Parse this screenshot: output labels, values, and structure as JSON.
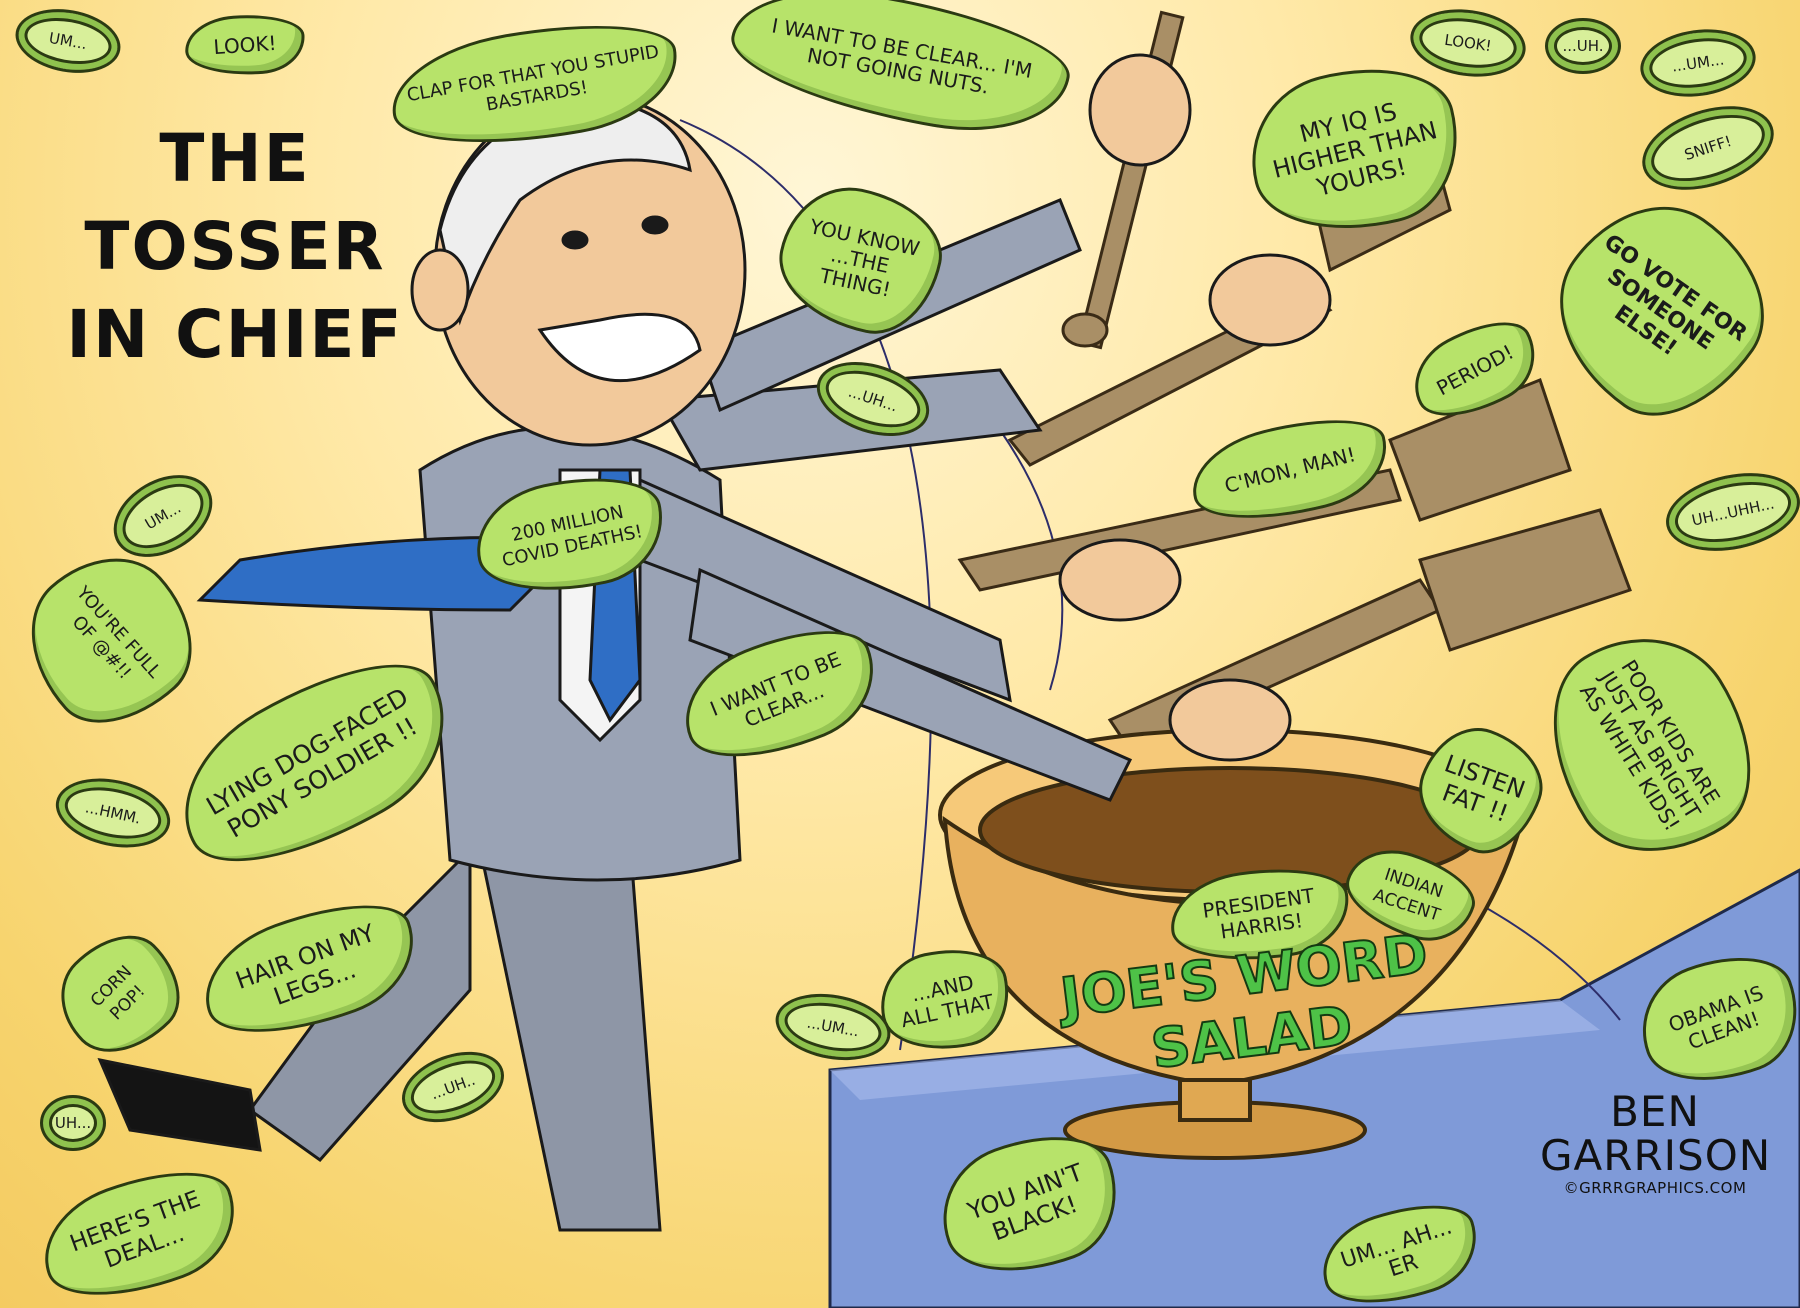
{
  "title_lines": [
    "THE",
    "TOSSER",
    "IN CHIEF"
  ],
  "bowl_label": [
    "JOE'S WORD",
    "SALAD"
  ],
  "signature": {
    "line1": "BEN",
    "line2": "GARRISON",
    "site": "©GRRRGRAPHICS.COM"
  },
  "leaves": [
    "CLAP FOR THAT YOU STUPID BASTARDS!",
    "I WANT TO BE CLEAR... I'M NOT GOING NUTS.",
    "MY IQ IS HIGHER THAN YOURS!",
    "YOU KNOW ...THE THING!",
    "GO VOTE FOR SOMEONE ELSE!",
    "PERIOD!",
    "C'MON, MAN!",
    "200 MILLION COVID DEATHS!",
    "YOU'RE FULL OF @#!!",
    "I WANT TO BE CLEAR...",
    "LYING DOG-FACED PONY SOLDIER !!",
    "POOR KIDS ARE JUST AS BRIGHT AS WHITE KIDS!",
    "LISTEN FAT !!",
    "PRESIDENT HARRIS!",
    "INDIAN ACCENT",
    "CORN POP!",
    "HAIR ON MY LEGS...",
    "...AND ALL THAT",
    "OBAMA IS CLEAN!",
    "YOU AIN'T BLACK!",
    "HERE'S THE DEAL...",
    "UM... AH... ER",
    "LOOK!"
  ],
  "slices": [
    "UM...",
    "LOOK!",
    "...UH.",
    "...UM...",
    "SNIFF!",
    "...UH...",
    "UM...",
    "UH...UHH...",
    "...HMM.",
    "...UM...",
    "...UH..",
    "UH..."
  ]
}
